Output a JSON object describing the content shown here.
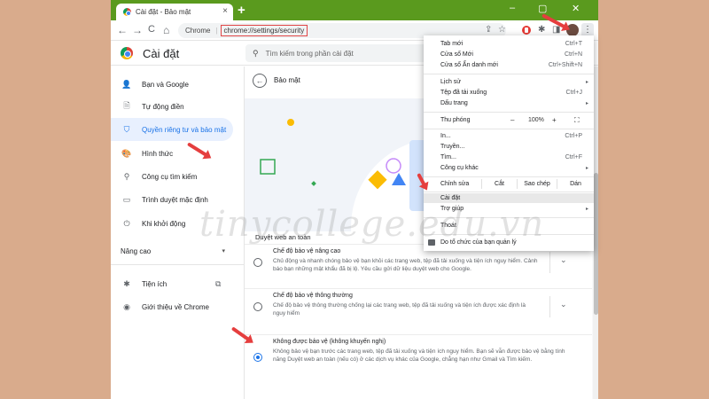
{
  "tab": {
    "title": "Cài đặt - Bảo mật",
    "close": "×",
    "new": "+"
  },
  "window_controls": {
    "minimize": "–",
    "maximize": "▢",
    "close": "✕"
  },
  "toolbar": {
    "back": "←",
    "forward": "→",
    "reload": "C",
    "home": "⌂",
    "site_label": "Chrome",
    "url": "chrome://settings/security",
    "share": "⇪",
    "star": "☆",
    "puzzle": "✱",
    "sidebar": "◨",
    "menu": "⋮"
  },
  "header": {
    "brand": "Cài đặt",
    "search_placeholder": "Tìm kiếm trong phần cài đặt",
    "search_icon": "⚲"
  },
  "sidebar": {
    "items": [
      {
        "label": "Bạn và Google",
        "icon": "👤"
      },
      {
        "label": "Tự động điền",
        "icon": "🗎"
      },
      {
        "label": "Quyền riêng tư và bảo mật",
        "icon": "⛉"
      },
      {
        "label": "Hình thức",
        "icon": "🎨"
      },
      {
        "label": "Công cụ tìm kiếm",
        "icon": "⚲"
      },
      {
        "label": "Trình duyệt mặc định",
        "icon": "▭"
      },
      {
        "label": "Khi khởi động",
        "icon": "⏻"
      }
    ],
    "advanced": "Nâng cao",
    "advanced_chev": "▾",
    "extensions": {
      "label": "Tiện ích",
      "icon": "✱",
      "ext_icon": "⧉"
    },
    "about": {
      "label": "Giới thiệu về Chrome",
      "icon": "◉"
    }
  },
  "content": {
    "back": "←",
    "title": "Bảo mật",
    "section_label": "Duyệt web an toàn",
    "options": [
      {
        "title": "Chế độ bảo vệ nâng cao",
        "desc": "Chủ động và nhanh chóng bảo vệ bạn khỏi các trang web, tệp đã tải xuống và tiện ích nguy hiểm. Cảnh báo bạn những mật khẩu đã bị lộ. Yêu cầu gửi dữ liệu duyệt web cho Google.",
        "selected": false,
        "chev": "⌄"
      },
      {
        "title": "Chế độ bảo vệ thông thường",
        "desc": "Chế độ bảo vệ thông thường chống lại các trang web, tệp đã tải xuống và tiện ích được xác định là nguy hiểm",
        "selected": false,
        "chev": "⌄"
      },
      {
        "title": "Không được bảo vệ (không khuyến nghị)",
        "desc": "Không bảo vệ bạn trước các trang web, tệp đã tải xuống và tiện ích nguy hiểm. Bạn sẽ vẫn được bảo vệ bằng tính năng Duyệt web an toàn (nếu có) ở các dịch vụ khác của Google, chẳng hạn như Gmail và Tìm kiếm.",
        "selected": true
      }
    ]
  },
  "menu": {
    "new_tab": {
      "label": "Tab mới",
      "shortcut": "Ctrl+T"
    },
    "new_window": {
      "label": "Cửa sổ Mới",
      "shortcut": "Ctrl+N"
    },
    "incognito": {
      "label": "Cửa sổ Ẩn danh mới",
      "shortcut": "Ctrl+Shift+N"
    },
    "history": {
      "label": "Lịch sử",
      "arrow": "▸"
    },
    "downloads": {
      "label": "Tệp đã tải xuống",
      "shortcut": "Ctrl+J"
    },
    "bookmarks": {
      "label": "Dấu trang",
      "arrow": "▸"
    },
    "zoom": {
      "label": "Thu phóng",
      "minus": "–",
      "value": "100%",
      "plus": "+",
      "fullscreen": "⛶"
    },
    "print": {
      "label": "In...",
      "shortcut": "Ctrl+P"
    },
    "cast": {
      "label": "Truyền..."
    },
    "find": {
      "label": "Tìm...",
      "shortcut": "Ctrl+F"
    },
    "more_tools": {
      "label": "Công cụ khác",
      "arrow": "▸"
    },
    "edit": {
      "label": "Chỉnh sửa",
      "cut": "Cắt",
      "copy": "Sao chép",
      "paste": "Dán"
    },
    "settings": {
      "label": "Cài đặt"
    },
    "help": {
      "label": "Trợ giúp",
      "arrow": "▸"
    },
    "exit": {
      "label": "Thoát"
    },
    "managed": {
      "label": "Do tổ chức của bạn quản lý"
    }
  },
  "watermark": "tinycollege.edu.vn",
  "colors": {
    "titlebar": "#5a9a1e",
    "accent": "#1a73e8",
    "annotation": "#e53e3e",
    "background": "#d9ab8c"
  }
}
